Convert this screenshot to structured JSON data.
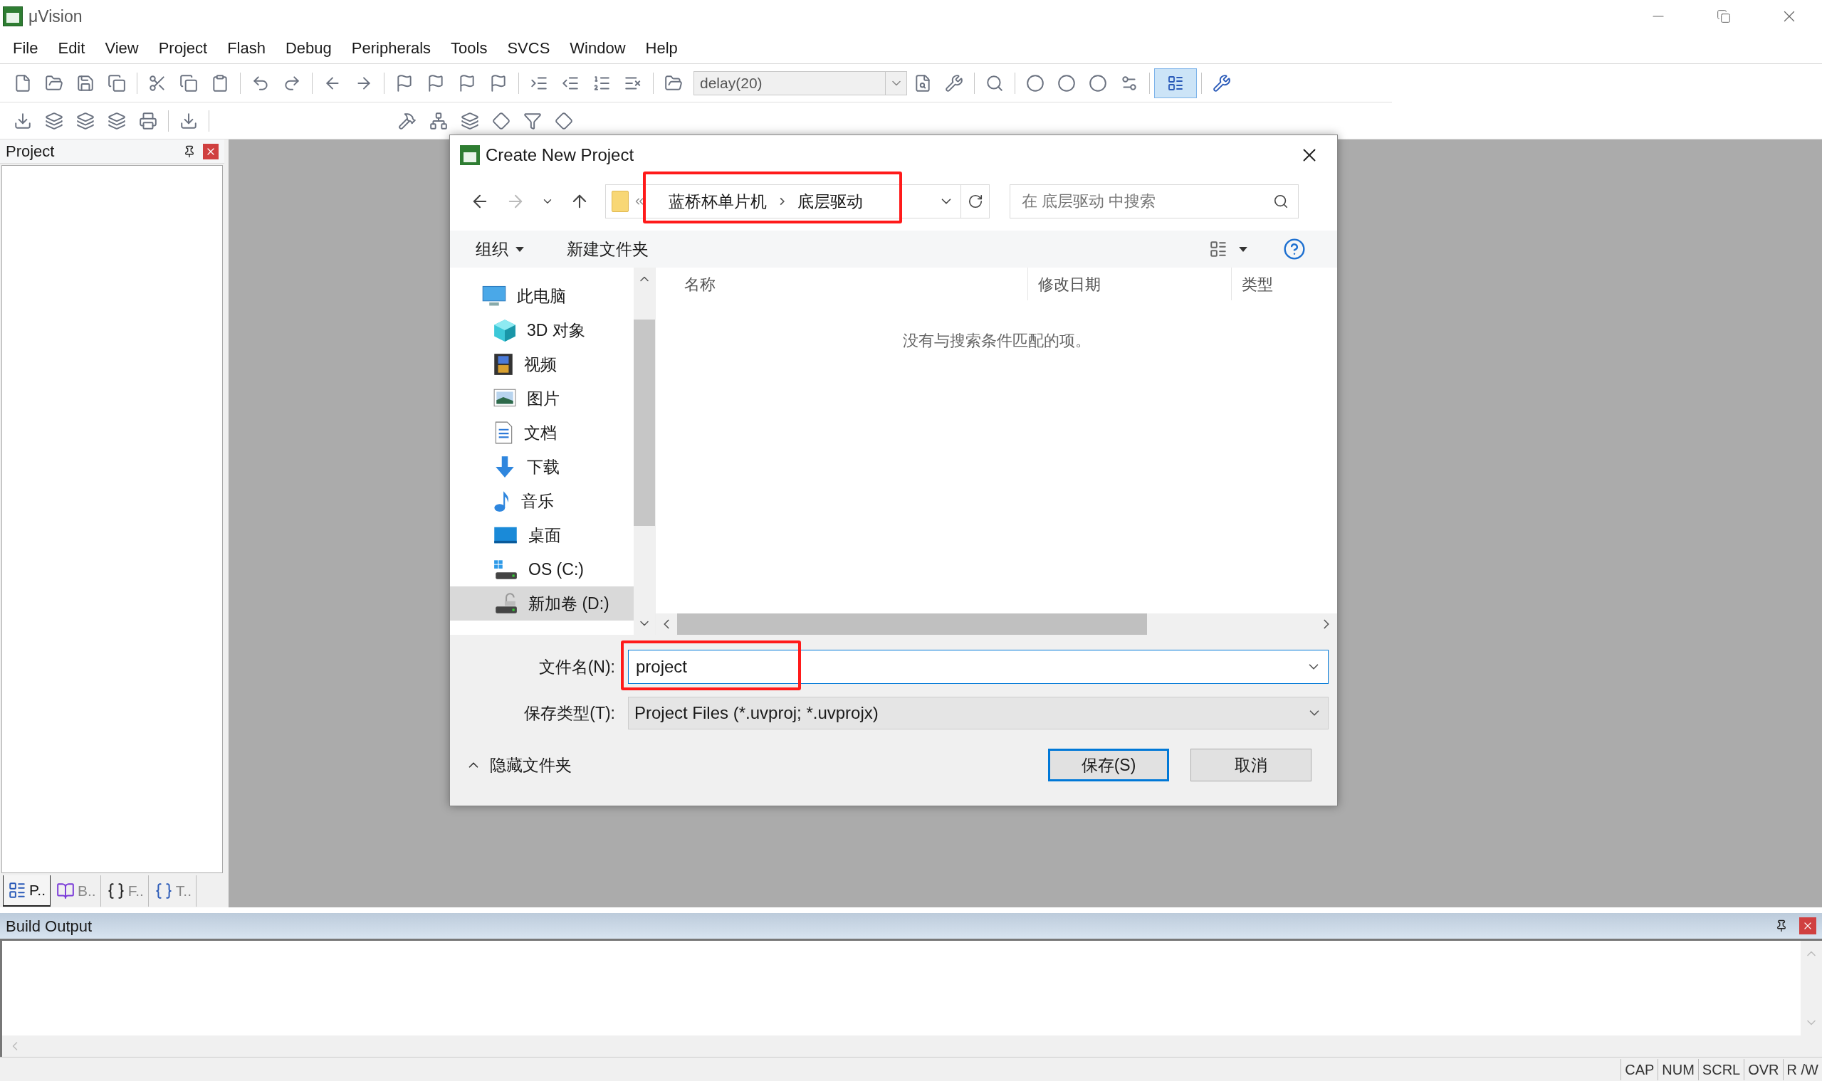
{
  "window": {
    "title": "μVision"
  },
  "menu": [
    "File",
    "Edit",
    "View",
    "Project",
    "Flash",
    "Debug",
    "Peripherals",
    "Tools",
    "SVCS",
    "Window",
    "Help"
  ],
  "toolbar": {
    "find_combo": "delay(20)"
  },
  "project_pane": {
    "title": "Project",
    "tabs": [
      {
        "label": "P..",
        "kind": "project",
        "selected": true
      },
      {
        "label": "B..",
        "kind": "books",
        "selected": false
      },
      {
        "label": "F..",
        "kind": "functions",
        "selected": false
      },
      {
        "label": "T..",
        "kind": "templates",
        "selected": false
      }
    ]
  },
  "build_output": {
    "title": "Build Output"
  },
  "status_bar": {
    "indicators": [
      "CAP",
      "NUM",
      "SCRL",
      "OVR",
      "R /W"
    ]
  },
  "dialog": {
    "title": "Create New Project",
    "breadcrumb": {
      "items": [
        "蓝桥杯单片机",
        "底层驱动"
      ],
      "highlighted": true
    },
    "search": {
      "placeholder": "在 底层驱动 中搜索"
    },
    "commands": [
      "组织",
      "新建文件夹"
    ],
    "nav_items": [
      {
        "label": "此电脑",
        "kind": "pc",
        "selected": false,
        "children": [
          {
            "label": "3D 对象",
            "kind": "cube",
            "selected": false
          },
          {
            "label": "视频",
            "kind": "video",
            "selected": false
          },
          {
            "label": "图片",
            "kind": "picture",
            "selected": false
          },
          {
            "label": "文档",
            "kind": "document",
            "selected": false
          },
          {
            "label": "下载",
            "kind": "download",
            "selected": false
          },
          {
            "label": "音乐",
            "kind": "music",
            "selected": false
          },
          {
            "label": "桌面",
            "kind": "desktop",
            "selected": false
          },
          {
            "label": "OS (C:)",
            "kind": "system_drive",
            "selected": false
          },
          {
            "label": "新加卷 (D:)",
            "kind": "drive",
            "selected": true
          }
        ]
      }
    ],
    "columns": [
      "名称",
      "修改日期",
      "类型"
    ],
    "empty_message": "没有与搜索条件匹配的项。",
    "file_name": {
      "label": "文件名(N):",
      "value": "project",
      "highlighted": true
    },
    "file_type": {
      "label": "保存类型(T):",
      "value": "Project Files (*.uvproj; *.uvprojx)"
    },
    "hide_folders": "隐藏文件夹",
    "buttons": [
      {
        "label": "保存(S)",
        "kind": "primary"
      },
      {
        "label": "取消",
        "kind": "secondary"
      }
    ]
  }
}
